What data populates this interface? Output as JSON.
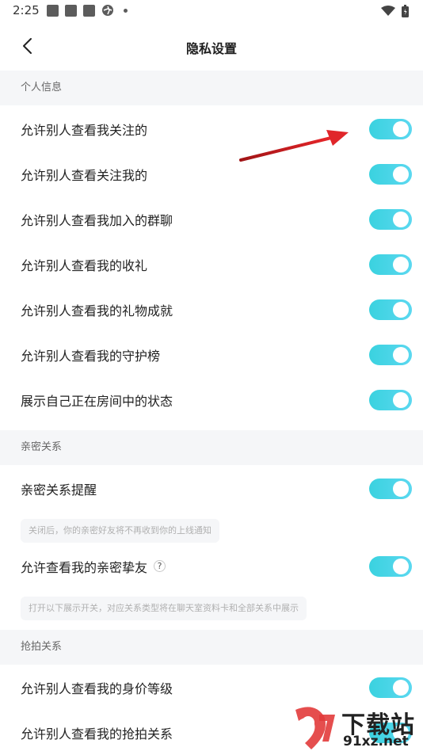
{
  "status_bar": {
    "time": "2:25"
  },
  "nav": {
    "title": "隐私设置"
  },
  "sections": {
    "personal": {
      "title": "个人信息"
    },
    "intimate": {
      "title": "亲密关系"
    },
    "snatch": {
      "title": "抢拍关系"
    }
  },
  "rows": {
    "view_my_follows": "允许别人查看我关注的",
    "view_followers": "允许别人查看关注我的",
    "view_groups": "允许别人查看我加入的群聊",
    "view_gifts": "允许别人查看我的收礼",
    "view_gift_achievements": "允许别人查看我的礼物成就",
    "view_guardian_list": "允许别人查看我的守护榜",
    "show_room_status": "展示自己正在房间中的状态",
    "intimate_reminder": "亲密关系提醒",
    "view_close_friends": "允许查看我的亲密挚友",
    "view_worth_level": "允许别人查看我的身价等级",
    "view_snatch_relations": "允许别人查看我的抢拍关系"
  },
  "help": {
    "symbol": "?"
  },
  "hints": {
    "intimate_reminder_hint": "关闭后，你的亲密好友将不再收到你的上线通知",
    "close_friends_hint": "打开以下展示开关，对应关系类型将在聊天室资料卡和全部关系中展示"
  },
  "toggles": {
    "view_my_follows": true,
    "view_followers": true,
    "view_groups": true,
    "view_gifts": true,
    "view_gift_achievements": true,
    "view_guardian_list": true,
    "show_room_status": true,
    "intimate_reminder": true,
    "view_close_friends": true,
    "view_worth_level": true,
    "view_snatch_relations": true
  },
  "watermark": {
    "text": "下载站",
    "url": "91xz.net"
  },
  "colors": {
    "toggle_on": "#3ad2df",
    "section_bg": "#f5f6f8",
    "arrow": "#d9262b"
  }
}
